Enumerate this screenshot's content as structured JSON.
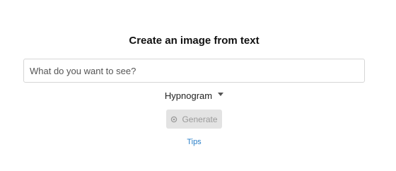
{
  "header": {
    "title": "Create an image from text"
  },
  "prompt": {
    "placeholder": "What do you want to see?",
    "value": ""
  },
  "style_selector": {
    "selected": "Hypnogram",
    "icon": "caret-down-icon"
  },
  "generate_button": {
    "label": "Generate",
    "icon": "gear-icon",
    "state": "disabled"
  },
  "tips": {
    "label": "Tips"
  },
  "colors": {
    "link": "#2a7fc8",
    "button_disabled_bg": "#e3e3e3",
    "button_disabled_text": "#9a9a9a"
  }
}
